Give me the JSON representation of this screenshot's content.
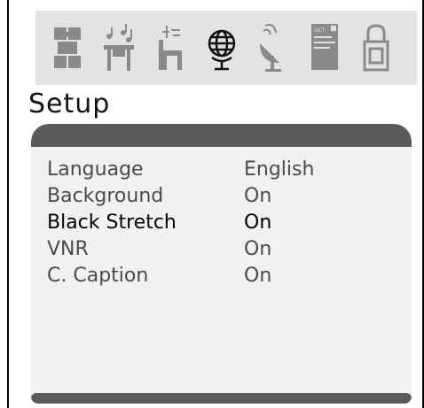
{
  "window": {
    "title": "Setup"
  },
  "icons": [
    {
      "name": "puzzle-icon"
    },
    {
      "name": "music-table-icon"
    },
    {
      "name": "chair-icon"
    },
    {
      "name": "globe-icon"
    },
    {
      "name": "satellite-dish-icon"
    },
    {
      "name": "dct-card-icon"
    },
    {
      "name": "lock-icon"
    }
  ],
  "dct_label": "DCT",
  "menu": {
    "rows": [
      {
        "label": "Language",
        "value": "English"
      },
      {
        "label": "Background",
        "value": "On"
      },
      {
        "label": "Black Stretch",
        "value": "On",
        "selected": true
      },
      {
        "label": "VNR",
        "value": "On"
      },
      {
        "label": "C. Caption",
        "value": "On"
      }
    ]
  },
  "colors": {
    "icon_gray": "#8a8a8a",
    "panel_bar": "#5a5a5a",
    "text_gray": "#4a4a4a"
  }
}
